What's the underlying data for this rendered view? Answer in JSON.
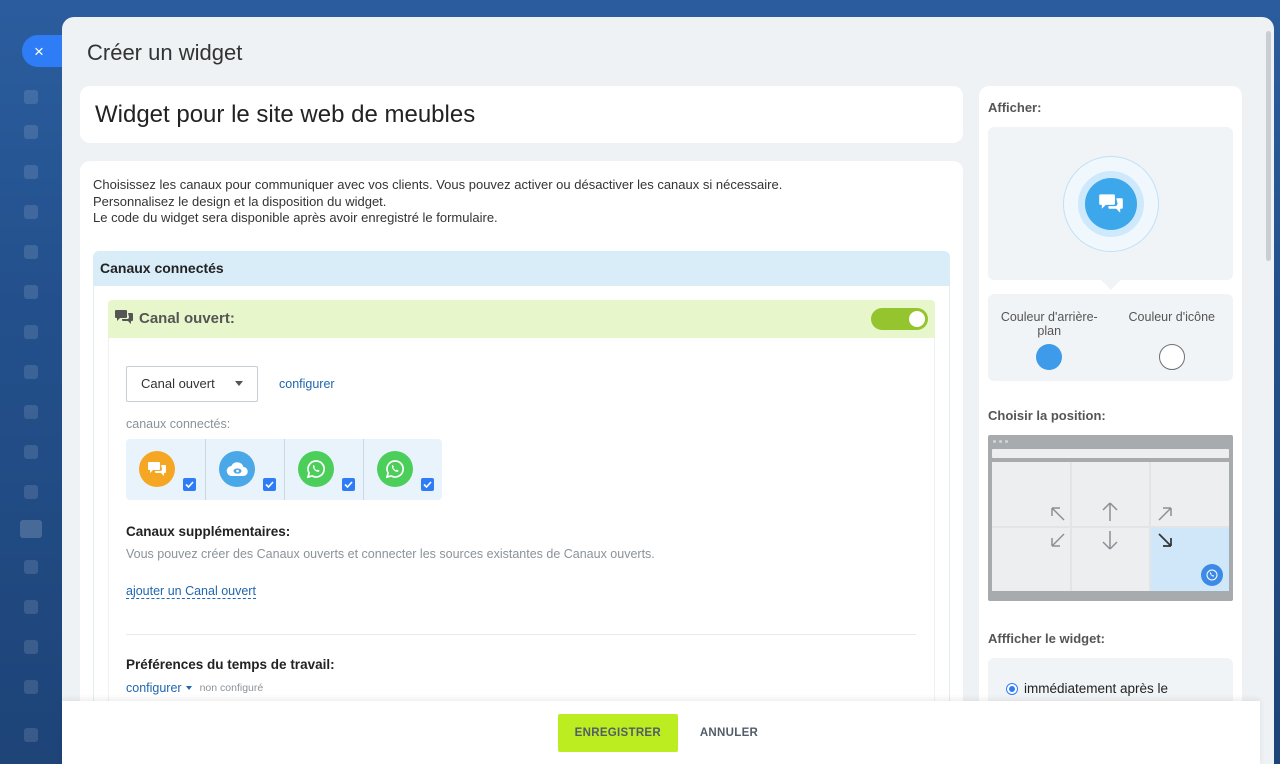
{
  "panel": {
    "title": "Créer un widget",
    "close_glyph": "×"
  },
  "widget_name": "Widget pour le site web de meubles",
  "intro": {
    "line1": "Choisissez les canaux pour communiquer avec vos clients. Vous pouvez activer ou désactiver les canaux si nécessaire.",
    "line2": "Personnalisez le design et la disposition du widget.",
    "line3": "Le code du widget sera disponible après avoir enregistré le formulaire."
  },
  "connected_channels": {
    "title": "Canaux connectés",
    "open_channel": {
      "title": "Canal ouvert:",
      "enabled": true,
      "select_value": "Canal ouvert",
      "configure_link": "configurer",
      "connected_label": "canaux connectés:",
      "channels": [
        {
          "icon": "chat-bubbles-icon",
          "color": "#f5a623",
          "checked": true
        },
        {
          "icon": "cloud-eye-icon",
          "color": "#4aa8e8",
          "checked": true
        },
        {
          "icon": "whatsapp-icon",
          "color": "#4cce5b",
          "checked": true
        },
        {
          "icon": "whatsapp-icon",
          "color": "#4cce5b",
          "checked": true
        }
      ],
      "extra_title": "Canaux supplémentaires:",
      "extra_desc": "Vous pouvez créer des Canaux ouverts et connecter les sources existantes de Canaux ouverts.",
      "add_link": "ajouter un Canal ouvert",
      "prefs_title": "Préférences du temps de travail:",
      "prefs_link": "configurer",
      "prefs_status": "non configuré"
    }
  },
  "sidebar": {
    "show_label": "Afficher:",
    "bg_color_label": "Couleur d'arrière-plan",
    "icon_color_label": "Couleur d'icône",
    "bg_color": "#3d9be9",
    "icon_color": "#ffffff",
    "position_label": "Choisir la position:",
    "selected_position": "bottom-right",
    "display_label": "Affficher le widget:",
    "display_option": "immédiatement après le"
  },
  "footer": {
    "save": "ENREGISTRER",
    "cancel": "ANNULER"
  }
}
